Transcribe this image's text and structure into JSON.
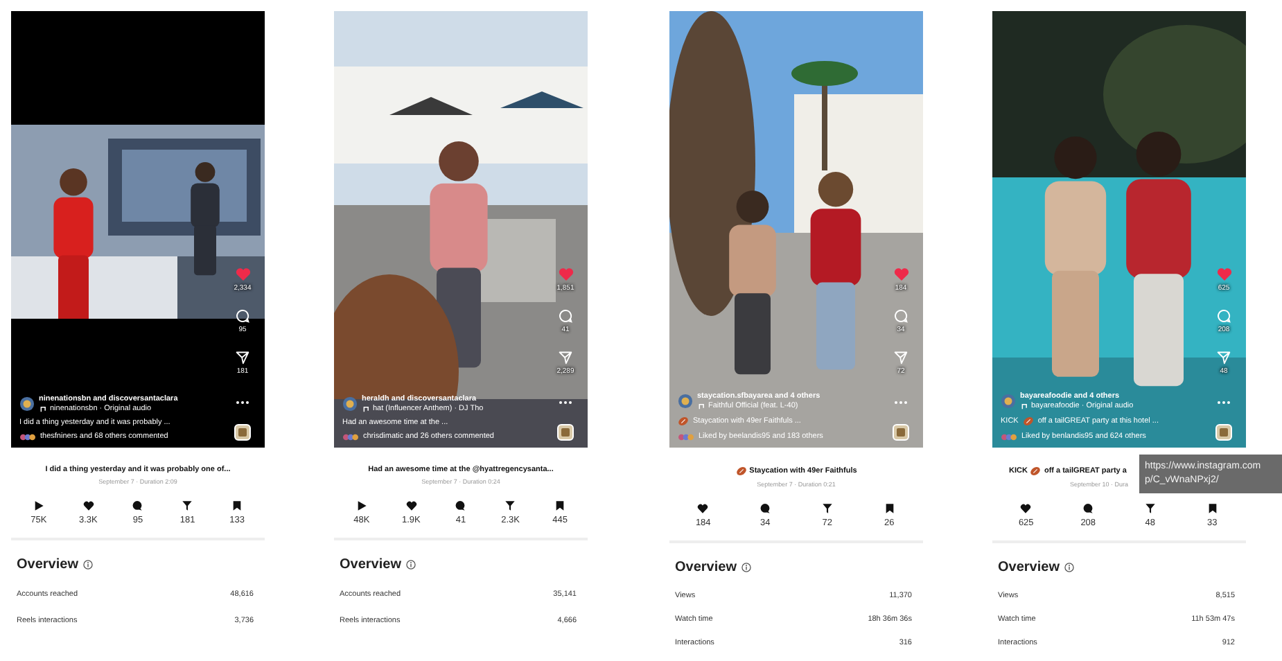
{
  "reels": [
    {
      "kind": "letterbox",
      "overlay": {
        "likes": "2,334",
        "comments": "95",
        "shares": "181",
        "account": "ninenationsbn and discoversantaclara",
        "audio": "ninenationsbn · Original audio",
        "caption": [
          {
            "kind": "text",
            "text": "I did a thing yesterday and it was probably ..."
          }
        ],
        "activity": "thesfniners and 68 others commented"
      },
      "title": [
        {
          "kind": "text",
          "text": "I did a thing yesterday and it was probably one of..."
        }
      ],
      "meta": "September 7 · Duration 2:09",
      "metrics": [
        {
          "kind": "plays",
          "value": "75K"
        },
        {
          "kind": "likes",
          "value": "3.3K"
        },
        {
          "kind": "comments",
          "value": "95"
        },
        {
          "kind": "shares",
          "value": "181"
        },
        {
          "kind": "saves",
          "value": "133"
        }
      ],
      "overview": {
        "title": "Overview",
        "rows": [
          {
            "label": "Accounts reached",
            "value": "48,616"
          },
          {
            "label": "Reels interactions",
            "value": "3,736"
          }
        ]
      }
    },
    {
      "kind": "full",
      "overlay": {
        "likes": "1,851",
        "comments": "41",
        "shares": "2,289",
        "account": "heraldh and discoversantaclara",
        "audio": "hat (Influencer Anthem) · DJ Tho",
        "caption": [
          {
            "kind": "text",
            "text": "Had an awesome time at the ..."
          }
        ],
        "activity": "chrisdimatic and 26 others commented"
      },
      "title": [
        {
          "kind": "text",
          "text": "Had an awesome time at the @hyattregencysanta..."
        }
      ],
      "meta": "September 7 · Duration 0:24",
      "metrics": [
        {
          "kind": "plays",
          "value": "48K"
        },
        {
          "kind": "likes",
          "value": "1.9K"
        },
        {
          "kind": "comments",
          "value": "41"
        },
        {
          "kind": "shares",
          "value": "2.3K"
        },
        {
          "kind": "saves",
          "value": "445"
        }
      ],
      "overview": {
        "title": "Overview",
        "rows": [
          {
            "label": "Accounts reached",
            "value": "35,141"
          },
          {
            "label": "Reels interactions",
            "value": "4,666"
          }
        ]
      }
    },
    {
      "kind": "full",
      "overlay": {
        "likes": "184",
        "comments": "34",
        "shares": "72",
        "account": "staycation.sfbayarea and 4 others",
        "audio": "Faithful Official (feat. L-40)",
        "caption": [
          {
            "kind": "football"
          },
          {
            "kind": "text",
            "text": "Staycation with 49er Faithfuls ..."
          }
        ],
        "activity": "Liked by beelandis95 and 183 others"
      },
      "title": [
        {
          "kind": "football"
        },
        {
          "kind": "text",
          "text": "Staycation with 49er Faithfuls"
        }
      ],
      "meta": "September 7 · Duration 0:21",
      "metrics": [
        {
          "kind": "likes",
          "value": "184"
        },
        {
          "kind": "comments",
          "value": "34"
        },
        {
          "kind": "shares",
          "value": "72"
        },
        {
          "kind": "saves",
          "value": "26"
        }
      ],
      "overview": {
        "title": "Overview",
        "rows": [
          {
            "label": "Views",
            "value": "11,370"
          },
          {
            "label": "Watch time",
            "value": "18h 36m 36s"
          },
          {
            "label": "Interactions",
            "value": "316"
          }
        ]
      }
    },
    {
      "kind": "full",
      "overlay": {
        "likes": "625",
        "comments": "208",
        "shares": "48",
        "account": "bayareafoodie and 4 others",
        "audio": "bayareafoodie · Original audio",
        "caption": [
          {
            "kind": "text",
            "text": "KICK"
          },
          {
            "kind": "football"
          },
          {
            "kind": "text",
            "text": "off a tailGREAT party at this hotel ..."
          }
        ],
        "activity": "Liked by benlandis95 and 624 others"
      },
      "title": [
        {
          "kind": "text",
          "text": "KICK"
        },
        {
          "kind": "football"
        },
        {
          "kind": "text",
          "text": "off a tailGREAT party a"
        }
      ],
      "meta": "September 10 · Dura",
      "metrics": [
        {
          "kind": "likes",
          "value": "625"
        },
        {
          "kind": "comments",
          "value": "208"
        },
        {
          "kind": "shares",
          "value": "48"
        },
        {
          "kind": "saves",
          "value": "33"
        }
      ],
      "overview": {
        "title": "Overview",
        "rows": [
          {
            "label": "Views",
            "value": "8,515"
          },
          {
            "label": "Watch time",
            "value": "11h 53m 47s"
          },
          {
            "label": "Interactions",
            "value": "912"
          }
        ]
      }
    }
  ],
  "tooltip": {
    "lines": [
      "https://www.instagram.com",
      "p/C_vWnaNPxj2/"
    ]
  }
}
